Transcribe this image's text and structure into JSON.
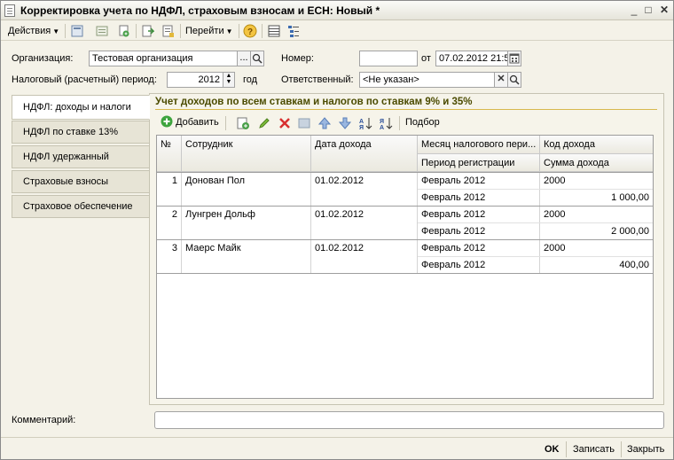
{
  "window": {
    "title": "Корректировка учета по НДФЛ, страховым взносам и ЕСН: Новый *",
    "minimize": "_",
    "maximize": "□",
    "close": "✕"
  },
  "toolbar": {
    "actions_label": "Действия",
    "goto_label": "Перейти",
    "icons": [
      "post-icon",
      "view-icon",
      "copy-icon",
      "export-icon",
      "print-icon",
      "help-icon",
      "list-icon",
      "structure-icon"
    ]
  },
  "header": {
    "org_label": "Организация:",
    "org_value": "Тестовая организация",
    "org_select": "...",
    "period_label": "Налоговый (расчетный) период:",
    "period_value": "2012",
    "period_unit": "год",
    "number_label": "Номер:",
    "number_value": "",
    "date_label": "от",
    "date_value": "07.02.2012 21:5",
    "responsible_label": "Ответственный:",
    "responsible_value": "<Не указан>",
    "clear": "✕"
  },
  "tabs": [
    {
      "label": "НДФЛ: доходы и налоги",
      "active": true
    },
    {
      "label": "НДФЛ по ставке 13%"
    },
    {
      "label": "НДФЛ удержанный"
    },
    {
      "label": "Страховые взносы"
    },
    {
      "label": "Страховое обеспечение"
    }
  ],
  "section": {
    "title": "Учет доходов по всем ставкам и налогов по ставкам 9% и 35%"
  },
  "grid_toolbar": {
    "add_label": "Добавить",
    "pick_label": "Подбор"
  },
  "table": {
    "headers": {
      "num": "№",
      "employee": "Сотрудник",
      "income_date": "Дата дохода",
      "tax_month": "Месяц налогового пери...",
      "reg_period": "Период регистрации",
      "income_code": "Код дохода",
      "income_sum": "Сумма дохода"
    },
    "rows": [
      {
        "num": "1",
        "employee": "Донован Пол",
        "income_date": "01.02.2012",
        "tax_month": "Февраль 2012",
        "reg_period": "Февраль 2012",
        "income_code": "2000",
        "income_sum": "1 000,00"
      },
      {
        "num": "2",
        "employee": "Лунгрен Дольф",
        "income_date": "01.02.2012",
        "tax_month": "Февраль 2012",
        "reg_period": "Февраль 2012",
        "income_code": "2000",
        "income_sum": "2 000,00"
      },
      {
        "num": "3",
        "employee": "Маерс Майк",
        "income_date": "01.02.2012",
        "tax_month": "Февраль 2012",
        "reg_period": "Февраль 2012",
        "income_code": "2000",
        "income_sum": "400,00"
      }
    ]
  },
  "footer": {
    "comment_label": "Комментарий:",
    "comment_value": "",
    "ok_label": "OK",
    "save_label": "Записать",
    "close_label": "Закрыть"
  },
  "colors": {
    "accent_title": "#4b4b00",
    "section_line": "#d8b84d",
    "add_icon": "#3ea43e",
    "delete_icon": "#d83030"
  }
}
